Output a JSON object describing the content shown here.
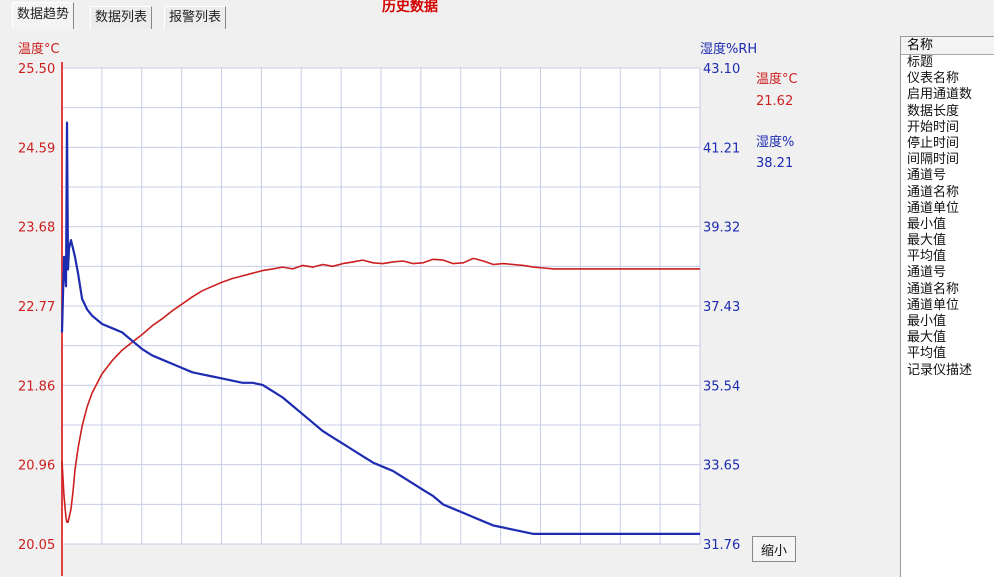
{
  "tabs": [
    {
      "label": "数据趋势",
      "active": true
    },
    {
      "label": "数据列表",
      "active": false
    },
    {
      "label": "报警列表",
      "active": false
    }
  ],
  "window_title": "历史数据",
  "readout": {
    "temp_label": "温度°C",
    "temp_value": "21.62",
    "hum_label": "湿度%",
    "hum_value": "38.21"
  },
  "zoom_button": "缩小",
  "side_panel": {
    "header": "名称",
    "items": [
      "标题",
      "仪表名称",
      "启用通道数",
      "数据长度",
      "开始时间",
      "停止时间",
      "间隔时间",
      "通道号",
      "通道名称",
      "通道单位",
      "最小值",
      "最大值",
      "平均值",
      "通道号",
      "通道名称",
      "通道单位",
      "最小值",
      "最大值",
      "平均值",
      "记录仪描述"
    ]
  },
  "colors": {
    "temperature": "#cc1f1f",
    "humidity": "#1c2bb0",
    "grid": "#c8cce8"
  },
  "chart_data": {
    "type": "line",
    "grid": true,
    "left_axis": {
      "title": "温度°C",
      "ticks": [
        "25.50",
        "24.59",
        "23.68",
        "22.77",
        "21.86",
        "20.96",
        "20.05"
      ],
      "ylim": [
        20.05,
        25.5
      ]
    },
    "right_axis": {
      "title": "湿度%RH",
      "ticks": [
        "43.10",
        "41.21",
        "39.32",
        "37.43",
        "35.54",
        "33.65",
        "31.76"
      ],
      "ylim": [
        31.76,
        43.1
      ]
    },
    "x": [
      0,
      2,
      4,
      5,
      6,
      7,
      9,
      11,
      13,
      16,
      20,
      25,
      30,
      40,
      50,
      60,
      70,
      80,
      90,
      100,
      110,
      120,
      130,
      140,
      150,
      160,
      170,
      180,
      190,
      200,
      210,
      220,
      230,
      240,
      250,
      260,
      270,
      280,
      290,
      300,
      310,
      320,
      330,
      340,
      350,
      360,
      370,
      380,
      390,
      400,
      410,
      420,
      430,
      440,
      450,
      460,
      470,
      480,
      490,
      500,
      510,
      520,
      530,
      540,
      550,
      560,
      570,
      580,
      590,
      600,
      610,
      620,
      630,
      636
    ],
    "series": [
      {
        "name": "温度°C",
        "axis": "left",
        "values": [
          21.0,
          20.6,
          20.35,
          20.3,
          20.3,
          20.35,
          20.45,
          20.65,
          20.9,
          21.15,
          21.4,
          21.62,
          21.78,
          22.0,
          22.15,
          22.27,
          22.36,
          22.45,
          22.55,
          22.63,
          22.72,
          22.8,
          22.88,
          22.95,
          23.0,
          23.05,
          23.09,
          23.12,
          23.15,
          23.18,
          23.2,
          23.22,
          23.2,
          23.24,
          23.22,
          23.25,
          23.23,
          23.26,
          23.28,
          23.3,
          23.27,
          23.26,
          23.28,
          23.29,
          23.26,
          23.27,
          23.31,
          23.3,
          23.26,
          23.27,
          23.32,
          23.29,
          23.25,
          23.26,
          23.25,
          23.24,
          23.22,
          23.21,
          23.2,
          23.2,
          23.2,
          23.2,
          23.2,
          23.2,
          23.2,
          23.2,
          23.2,
          23.2,
          23.2,
          23.2,
          23.2,
          23.2,
          23.2,
          23.2
        ]
      },
      {
        "name": "湿度%",
        "axis": "right",
        "values": [
          36.8,
          38.6,
          37.9,
          41.8,
          38.3,
          38.8,
          39.0,
          38.8,
          38.6,
          38.2,
          37.6,
          37.35,
          37.2,
          37.0,
          36.9,
          36.8,
          36.6,
          36.4,
          36.25,
          36.15,
          36.05,
          35.95,
          35.85,
          35.8,
          35.75,
          35.7,
          35.65,
          35.6,
          35.6,
          35.55,
          35.4,
          35.25,
          35.05,
          34.85,
          34.65,
          34.45,
          34.3,
          34.15,
          34.0,
          33.85,
          33.7,
          33.6,
          33.5,
          33.35,
          33.2,
          33.05,
          32.9,
          32.7,
          32.6,
          32.5,
          32.4,
          32.3,
          32.2,
          32.15,
          32.1,
          32.05,
          32.0,
          32.0,
          32.0,
          32.0,
          32.0,
          32.0,
          32.0,
          32.0,
          32.0,
          32.0,
          32.0,
          32.0,
          32.0,
          32.0,
          32.0,
          32.0,
          32.0,
          32.0
        ]
      }
    ],
    "xlim": [
      0,
      636
    ]
  }
}
